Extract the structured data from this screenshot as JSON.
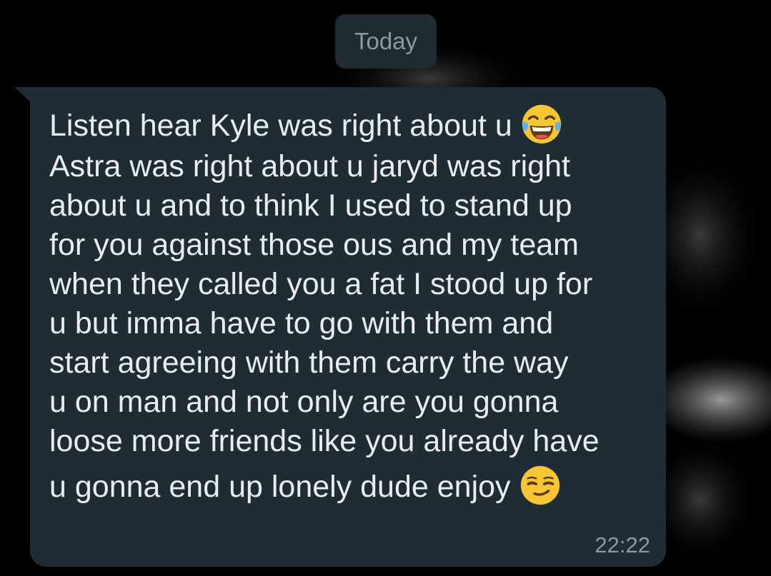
{
  "date_separator": {
    "label": "Today"
  },
  "message": {
    "lines": [
      "Listen hear Kyle was right about u",
      "Astra was right about u jaryd was right",
      "about u and to think I used to stand up",
      "for you against those ous and my team",
      "when they called you a fat I stood up for",
      "u but imma have to go with them and",
      "start agreeing with them carry the way",
      "u on man and not only are you gonna",
      "loose more friends like you already have",
      "u gonna end up lonely dude enjoy"
    ],
    "emoji_after_first_line": "face-with-tears-of-joy",
    "emoji_after_last_line": "smirking-face",
    "time": "22:22"
  },
  "colors": {
    "background": "#000000",
    "bubble": "#1f2c33",
    "text": "#e9edef",
    "meta_text": "#8c9aa1",
    "date_chip": "#1e2b31"
  }
}
